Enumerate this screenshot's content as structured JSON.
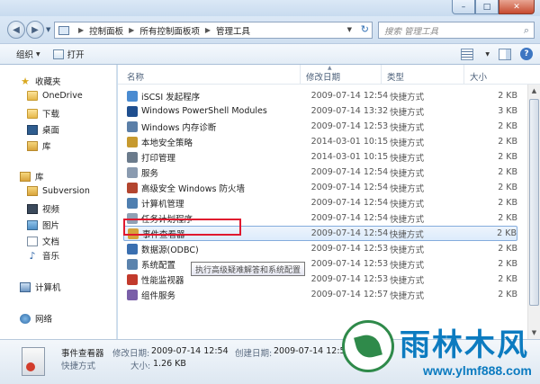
{
  "window": {
    "minimize_glyph": "–",
    "maximize_glyph": "□",
    "close_glyph": "✕"
  },
  "address": {
    "crumbs": [
      "控制面板",
      "所有控制面板项",
      "管理工具"
    ],
    "refresh_glyph": "↻"
  },
  "search": {
    "placeholder": "搜索 管理工具"
  },
  "toolbar": {
    "organize_label": "组织",
    "open_label": "打开",
    "help_glyph": "?"
  },
  "sidebar": {
    "items": [
      {
        "label": "收藏夹",
        "icon": "star-icon"
      },
      {
        "label": "OneDrive",
        "icon": "folder-icon"
      },
      {
        "label": "下载",
        "icon": "download-folder-icon"
      },
      {
        "label": "桌面",
        "icon": "desktop-icon"
      },
      {
        "label": "库",
        "icon": "library-icon"
      },
      {
        "label": "库",
        "icon": "library-icon"
      },
      {
        "label": "Subversion",
        "icon": "folder-icon"
      },
      {
        "label": "视频",
        "icon": "video-icon"
      },
      {
        "label": "图片",
        "icon": "picture-icon"
      },
      {
        "label": "文档",
        "icon": "document-icon"
      },
      {
        "label": "音乐",
        "icon": "music-icon"
      },
      {
        "label": "计算机",
        "icon": "computer-icon"
      },
      {
        "label": "网络",
        "icon": "network-icon"
      }
    ]
  },
  "columns": {
    "name": "名称",
    "date": "修改日期",
    "type": "类型",
    "size": "大小"
  },
  "files": [
    {
      "name": "iSCSI 发起程序",
      "date": "2009-07-14 12:54",
      "type": "快捷方式",
      "size": "2 KB",
      "color": "#4a8bd1"
    },
    {
      "name": "Windows PowerShell Modules",
      "date": "2009-07-14 13:32",
      "type": "快捷方式",
      "size": "3 KB",
      "color": "#1f4f8f"
    },
    {
      "name": "Windows 内存诊断",
      "date": "2009-07-14 12:53",
      "type": "快捷方式",
      "size": "2 KB",
      "color": "#5b7fa8"
    },
    {
      "name": "本地安全策略",
      "date": "2014-03-01 10:15",
      "type": "快捷方式",
      "size": "2 KB",
      "color": "#c79a2f"
    },
    {
      "name": "打印管理",
      "date": "2014-03-01 10:15",
      "type": "快捷方式",
      "size": "2 KB",
      "color": "#6b7b8c"
    },
    {
      "name": "服务",
      "date": "2009-07-14 12:54",
      "type": "快捷方式",
      "size": "2 KB",
      "color": "#8a9bb0"
    },
    {
      "name": "高级安全 Windows 防火墙",
      "date": "2009-07-14 12:54",
      "type": "快捷方式",
      "size": "2 KB",
      "color": "#b3452f"
    },
    {
      "name": "计算机管理",
      "date": "2009-07-14 12:54",
      "type": "快捷方式",
      "size": "2 KB",
      "color": "#4f7fb0"
    },
    {
      "name": "任务计划程序",
      "date": "2009-07-14 12:54",
      "type": "快捷方式",
      "size": "2 KB",
      "color": "#8fa0b4"
    },
    {
      "name": "事件查看器",
      "date": "2009-07-14 12:54",
      "type": "快捷方式",
      "size": "2 KB",
      "color": "#d6a23a",
      "selected": true
    },
    {
      "name": "数据源(ODBC)",
      "date": "2009-07-14 12:53",
      "type": "快捷方式",
      "size": "2 KB",
      "color": "#3a6fb0"
    },
    {
      "name": "系统配置",
      "date": "2009-07-14 12:53",
      "type": "快捷方式",
      "size": "2 KB",
      "color": "#5b83ad"
    },
    {
      "name": "性能监视器",
      "date": "2009-07-14 12:53",
      "type": "快捷方式",
      "size": "2 KB",
      "color": "#c23a2c"
    },
    {
      "name": "组件服务",
      "date": "2009-07-14 12:57",
      "type": "快捷方式",
      "size": "2 KB",
      "color": "#7a5fa8"
    }
  ],
  "tooltip": "执行高级疑难解答和系统配置",
  "details": {
    "name": "事件查看器",
    "modified_label": "修改日期:",
    "modified_value": "2009-07-14 12:54",
    "created_label": "创建日期:",
    "created_value": "2009-07-14 12:54",
    "type": "快捷方式",
    "size_label": "大小:",
    "size_value": "1.26 KB"
  },
  "watermark": {
    "brand": "雨林木风",
    "url": "www.ylmf888.com"
  }
}
